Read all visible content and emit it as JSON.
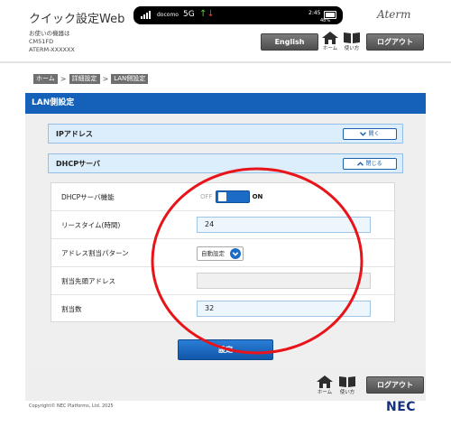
{
  "header": {
    "app_title": "クイック設定Web",
    "status": {
      "carrier": "docomo",
      "network": "5G",
      "battery_text": "2:45",
      "battery_pct": "48%"
    },
    "brand": "Aterm",
    "device_info": [
      "お使いの機器は",
      "CM51FD",
      "ATERM-XXXXXX"
    ],
    "english_label": "English",
    "home_label": "ホーム",
    "help_label": "使い方",
    "logout_label": "ログアウト"
  },
  "breadcrumb": [
    "ホーム",
    "詳細設定",
    "LAN側設定"
  ],
  "breadcrumb_sep": ">",
  "section_title": "LAN側設定",
  "accordions": [
    {
      "title": "IPアドレス",
      "toggle": "開く",
      "toggle_icon": "chevron-down-icon"
    },
    {
      "title": "DHCPサーバ",
      "toggle": "閉じる",
      "toggle_icon": "chevron-up-icon"
    }
  ],
  "form": {
    "dhcp_label": "DHCPサーバ機能",
    "dhcp_off": "OFF",
    "dhcp_on": "ON",
    "dhcp_state": "on",
    "lease_label": "リースタイム(時間)",
    "lease_value": "24",
    "pattern_label": "アドレス割当パターン",
    "pattern_value": "自動設定",
    "start_label": "割当先頭アドレス",
    "start_value": "",
    "count_label": "割当数",
    "count_value": "32"
  },
  "apply_label": "設定",
  "footer": {
    "home_label": "ホーム",
    "help_label": "使い方",
    "logout_label": "ログアウト",
    "copyright": "Copyright© NEC Platforms, Ltd. 2025",
    "logo": "NEC"
  },
  "colors": {
    "accent": "#1560b8",
    "annotation": "#e8141a",
    "accordion_bg": "#dcedfb"
  }
}
